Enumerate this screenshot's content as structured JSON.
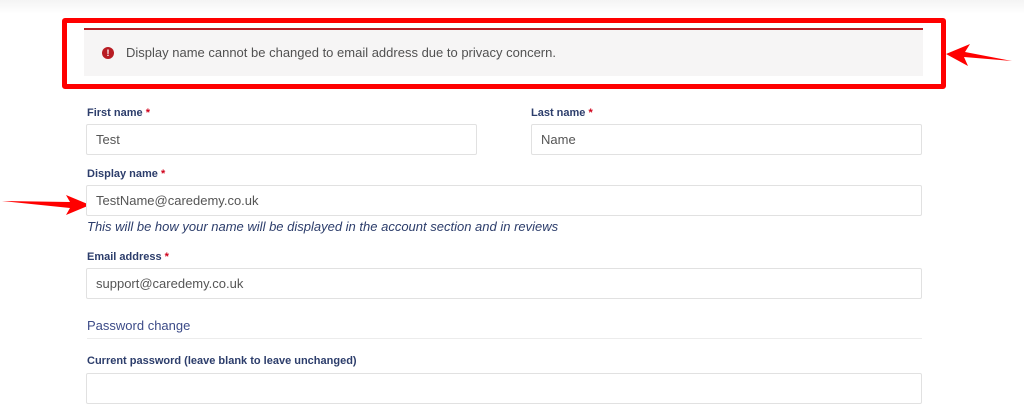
{
  "notice": {
    "icon": "exclamation-circle-icon",
    "icon_glyph": "!",
    "message": "Display name cannot be changed to email address due to privacy concern.",
    "color": "#b81c23"
  },
  "form": {
    "first_name": {
      "label": "First name",
      "required_mark": "*",
      "value": "Test"
    },
    "last_name": {
      "label": "Last name",
      "required_mark": "*",
      "value": "Name"
    },
    "display_name": {
      "label": "Display name",
      "required_mark": "*",
      "value": "TestName@caredemy.co.uk",
      "help": "This will be how your name will be displayed in the account section and in reviews"
    },
    "email": {
      "label": "Email address",
      "required_mark": "*",
      "value": "support@caredemy.co.uk"
    },
    "password_change": {
      "legend": "Password change"
    },
    "current_password": {
      "label": "Current password (leave blank to leave unchanged)"
    }
  },
  "annotations": {
    "highlight_color": "#ff0000",
    "arrow_icons": [
      "arrow-left-icon",
      "arrow-right-icon"
    ]
  }
}
